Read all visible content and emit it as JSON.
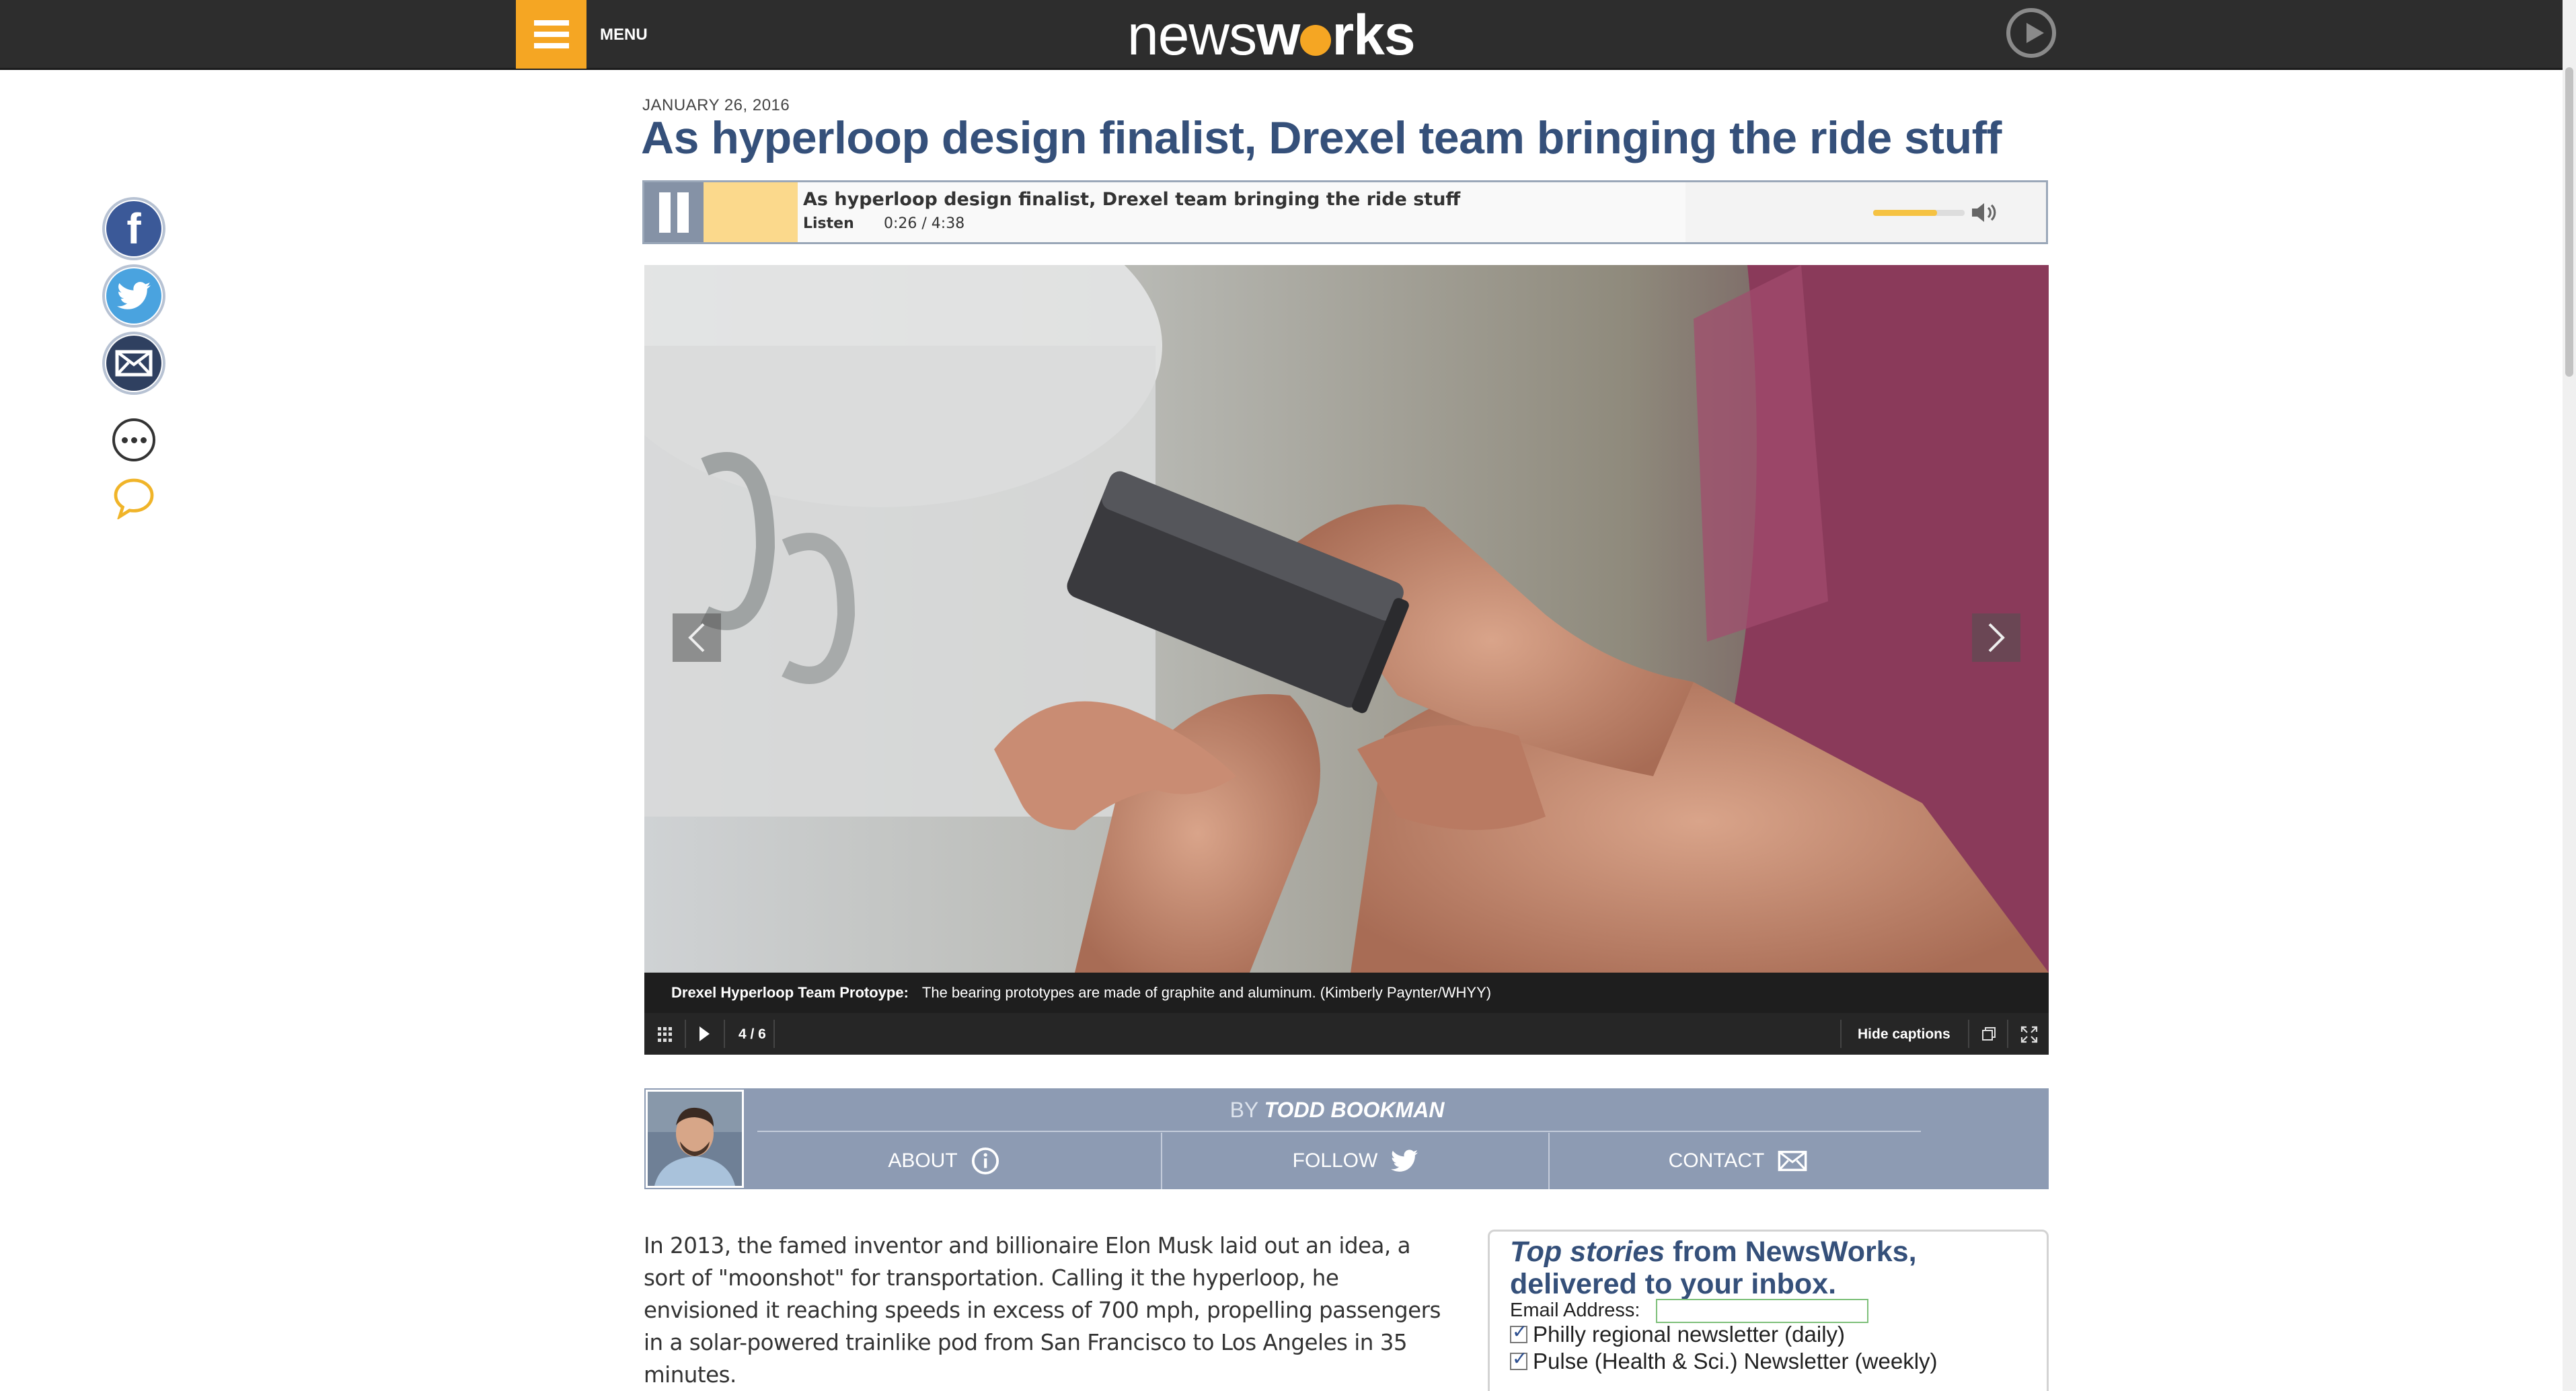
{
  "header": {
    "menu_label": "MENU",
    "logo_part1": "news",
    "logo_part2": "w",
    "logo_part3": "rks"
  },
  "social": [
    "facebook-icon",
    "twitter-icon",
    "email-icon",
    "more-icon",
    "comment-icon"
  ],
  "article": {
    "date": "JANUARY 26, 2016",
    "headline": "As hyperloop design finalist, Drexel team bringing the ride stuff"
  },
  "audio_player": {
    "title": "As hyperloop design finalist, Drexel team bringing the ride stuff",
    "listen_label": "Listen",
    "time": "0:26 / 4:38",
    "volume_level": 0.7
  },
  "slideshow": {
    "caption_title": "Drexel Hyperloop Team Protoype:",
    "caption_text": "The bearing prototypes are made of graphite and aluminum. (Kimberly Paynter/WHYY)",
    "counter": "4 / 6",
    "hide_captions_label": "Hide captions"
  },
  "author": {
    "by_label": "BY",
    "name": "TODD BOOKMAN",
    "about_label": "ABOUT",
    "follow_label": "FOLLOW",
    "contact_label": "CONTACT"
  },
  "body": {
    "paragraph1": "In 2013, the famed inventor and billionaire Elon Musk laid out an idea, a sort of \"moonshot\" for transportation. Calling it the hyperloop, he envisioned it reaching speeds in excess of 700 mph, propelling passengers in a solar-powered trainlike pod from San Francisco to Los Angeles in 35 minutes."
  },
  "newsletter": {
    "heading_em": "Top stories",
    "heading_rest1": " from NewsWorks,",
    "heading_rest2": "delivered to your inbox.",
    "email_label": "Email Address:",
    "email_value": "",
    "options": [
      {
        "label": "Philly regional newsletter (daily)",
        "checked": true
      },
      {
        "label": "Pulse (Health & Sci.) Newsletter (weekly)",
        "checked": true
      }
    ]
  },
  "colors": {
    "accent": "#f5a623",
    "headline": "#35507a",
    "author_bar": "#8d9bb3"
  }
}
